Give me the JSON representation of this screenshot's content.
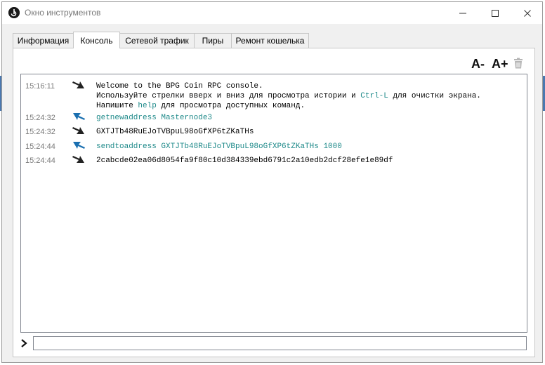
{
  "window": {
    "title": "Окно инструментов"
  },
  "tabs": [
    {
      "label": "Информация",
      "active": false
    },
    {
      "label": "Консоль",
      "active": true
    },
    {
      "label": "Сетевой трафик",
      "active": false
    },
    {
      "label": "Пиры",
      "active": false
    },
    {
      "label": "Ремонт кошелька",
      "active": false
    }
  ],
  "toolbar": {
    "font_smaller_label": "A-",
    "font_larger_label": "A+",
    "clear_icon": "trash-icon"
  },
  "console": {
    "entries": [
      {
        "time": "15:16:11",
        "direction": "reply",
        "lines": [
          "Welcome to the BPG Coin RPC console.",
          "Используйте стрелки вверх и вниз для просмотра истории и ",
          "Ctrl-L",
          " для очистки экрана.",
          "Напишите ",
          "help",
          " для просмотра доступных команд."
        ]
      },
      {
        "time": "15:24:32",
        "direction": "request",
        "text": "getnewaddress Masternode3"
      },
      {
        "time": "15:24:32",
        "direction": "reply",
        "text": "GXTJTb48RuEJoTVBpuL98oGfXP6tZKaTHs"
      },
      {
        "time": "15:24:44",
        "direction": "request",
        "text": "sendtoaddress GXTJTb48RuEJoTVBpuL98oGfXP6tZKaTHs 1000"
      },
      {
        "time": "15:24:44",
        "direction": "reply",
        "text": "2cabcde02ea06d8054fa9f80c10d384339ebd6791c2a10edb2dcf28efe1e89df"
      }
    ]
  },
  "input": {
    "value": "",
    "prompt_icon": "chevron-right-icon"
  },
  "colors": {
    "command_text": "#1f8a8a",
    "request_arrow": "#1a6fb0",
    "reply_arrow": "#222222"
  }
}
